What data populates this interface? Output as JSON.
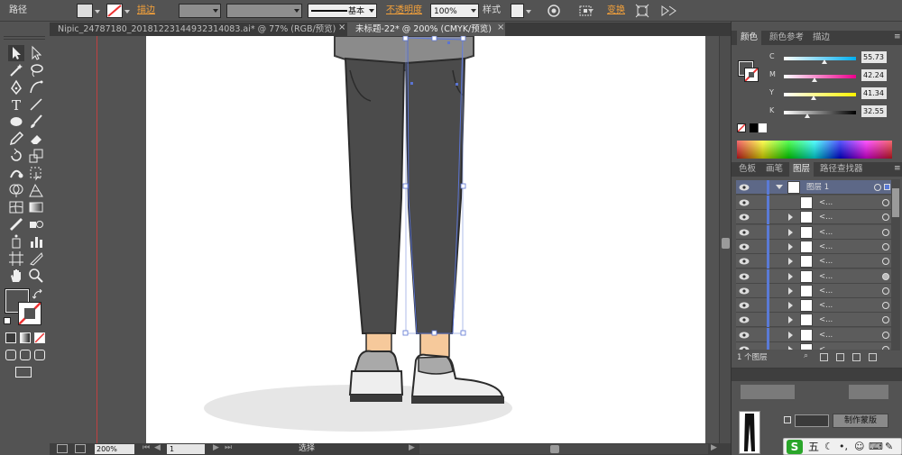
{
  "control_bar": {
    "object_type": "路径",
    "stroke_label": "描边",
    "brush_label": "基本",
    "opacity_label": "不透明度",
    "opacity_value": "100%",
    "style_label": "样式",
    "transform_label": "变换"
  },
  "tabs": [
    {
      "label": "Nipic_24787180_20181223144932314083.ai* @ 77% (RGB/预览)",
      "active": false
    },
    {
      "label": "未标题-22* @ 200% (CMYK/预览)",
      "active": true
    }
  ],
  "color_panel": {
    "tabs": [
      "颜色",
      "颜色参考",
      "描边"
    ],
    "channels": [
      {
        "letter": "C",
        "value": "55.73",
        "pos": 0.557
      },
      {
        "letter": "M",
        "value": "42.24",
        "pos": 0.422
      },
      {
        "letter": "Y",
        "value": "41.34",
        "pos": 0.413
      },
      {
        "letter": "K",
        "value": "32.55",
        "pos": 0.325
      }
    ]
  },
  "layers_panel": {
    "tabs": [
      "色板",
      "画笔",
      "图层",
      "路径查找器"
    ],
    "layer_name": "图层 1",
    "sublayer_label": "<...",
    "sublayer_count": 11,
    "footer": "1 个图层"
  },
  "bottom_panel": {
    "make_mask_label": "制作蒙版"
  },
  "status_bar": {
    "zoom": "200%",
    "page": "1",
    "tool": "选择"
  },
  "ime_bar": {
    "label": "五"
  },
  "colors": {
    "ui_bg": "#535353",
    "pants": "#4a4a4a",
    "shirt": "#8b8b8b",
    "skin": "#f6c99b",
    "shoe": "#eeeeee",
    "shoe_top": "#a9a9a9",
    "shadow": "#e6e6e6",
    "selection": "#5b74d2",
    "accent_orange": "#f6a23a"
  }
}
